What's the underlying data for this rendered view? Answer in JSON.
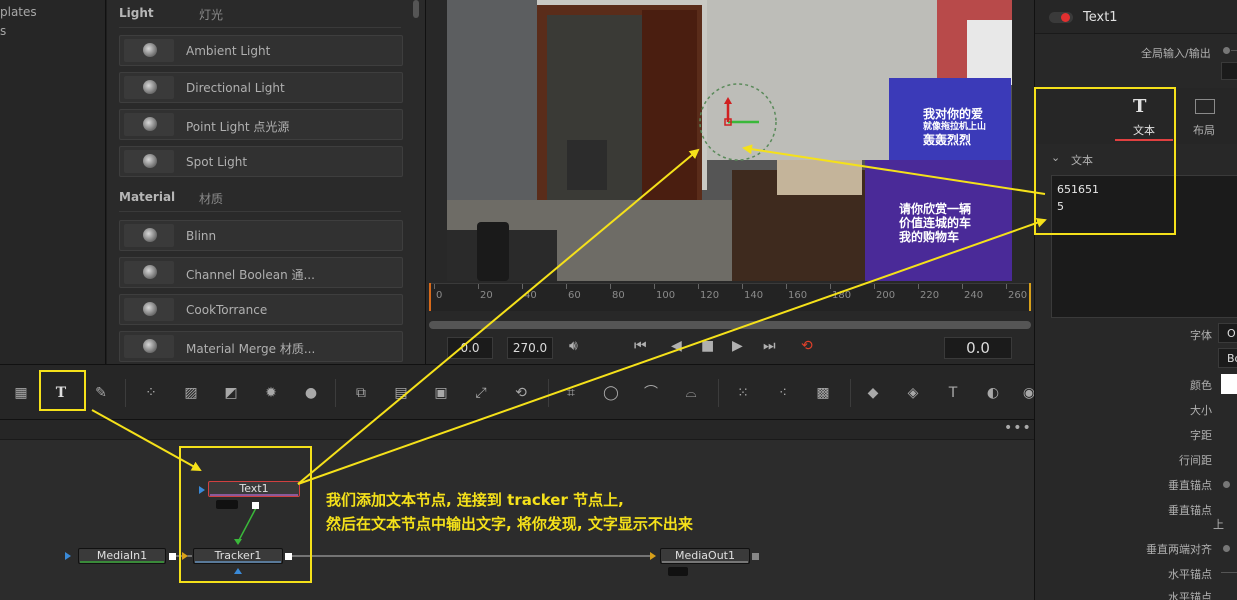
{
  "templates_panel": {
    "items": [
      "plates",
      "s"
    ]
  },
  "library": {
    "sections": [
      {
        "title": "Light",
        "title_cn": "灯光"
      },
      {
        "title": "Material",
        "title_cn": "材质"
      }
    ],
    "light_items": [
      {
        "label": "Ambient Light",
        "icon": "ambient-light-icon"
      },
      {
        "label": "Directional Light",
        "icon": "directional-light-icon"
      },
      {
        "label": "Point Light 点光源",
        "icon": "point-light-icon"
      },
      {
        "label": "Spot Light",
        "icon": "spot-light-icon"
      }
    ],
    "material_items": [
      {
        "label": "Blinn",
        "icon": "blinn-icon"
      },
      {
        "label": "Channel Boolean 通...",
        "icon": "channel-boolean-icon"
      },
      {
        "label": "CookTorrance",
        "icon": "cooktorrance-icon"
      },
      {
        "label": "Material Merge 材质...",
        "icon": "material-merge-icon"
      }
    ]
  },
  "viewer": {
    "video": {
      "poster_lines": [
        "我对你的爱",
        "就像拖拉机上山",
        "轰轰烈烈"
      ],
      "poster_lines_2": [
        "请你欣赏一辆",
        "价值连城的车",
        "我的购物车"
      ]
    },
    "ruler_ticks": [
      "0",
      "20",
      "40",
      "60",
      "80",
      "100",
      "120",
      "140",
      "160",
      "180",
      "200",
      "220",
      "240",
      "260"
    ],
    "time_in": "0.0",
    "time_out": "270.0",
    "current_time": "0.0"
  },
  "toolbar": {
    "icons": [
      "particle-icon",
      "text-tool-icon",
      "paint-brush-icon",
      "dots-icon",
      "grid-warp-icon",
      "curve-icon",
      "brightness-icon",
      "drop-icon",
      "merge-icon",
      "layer-icon",
      "image-plane-icon",
      "resize-icon",
      "transform-icon",
      "crop-icon",
      "ellipse-icon",
      "polygon-icon",
      "bspline-icon",
      "particle-emitter-icon",
      "particle-render-icon",
      "particle-pixel-icon",
      "shape3d-icon",
      "merge3d-icon",
      "text3d-icon",
      "camera3d-icon",
      "renderer3d-icon"
    ]
  },
  "nodes": {
    "text1": "Text1",
    "media_in": "MediaIn1",
    "tracker": "Tracker1",
    "media_out": "MediaOut1"
  },
  "inspector": {
    "node_name": "Text1",
    "global_io": "全局输入/输出",
    "tab_text": "文本",
    "tab_layout": "布局",
    "section_text": "文本",
    "text_content_line1": "651651",
    "text_content_line2": "5",
    "labels": {
      "font": "字体",
      "color": "颜色",
      "size": "大小",
      "tracking": "字距",
      "line_spacing": "行间距",
      "v_anchor": "垂直锚点",
      "v_anchor2": "垂直锚点",
      "v_anchor_value": "上",
      "v_justify": "垂直两端对齐",
      "h_anchor": "水平锚点",
      "h_anchor2": "水平锚点"
    },
    "font_value_1": "O",
    "font_value_2": "Bo"
  },
  "annotation": {
    "line1": "我们添加文本节点, 连接到 tracker 节点上,",
    "line2": "然后在文本节点中输出文字,  将你发现, 文字显示不出来"
  }
}
